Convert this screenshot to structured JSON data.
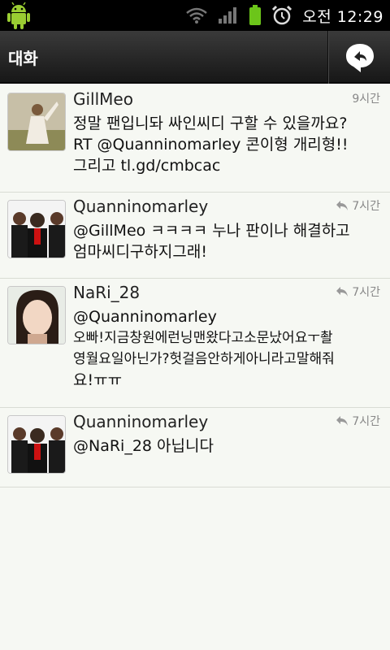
{
  "status": {
    "clock": "오전 12:29"
  },
  "header": {
    "title": "대화"
  },
  "tweets": [
    {
      "name": "GillMeo",
      "time": "9시간",
      "lines": [
        "정말 팬입니돠 싸인씨디 구할 수 있을까요?",
        "RT @Quanninomarley 콘이형 개리형!!",
        "그리고 tl.gd/cmbcac"
      ]
    },
    {
      "name": "Quanninomarley",
      "time": "7시간",
      "lines": [
        "@GillMeo ㅋㅋㅋㅋ 누나 판이나 해결하고",
        "엄마씨디구하지그래!"
      ]
    },
    {
      "name": "NaRi_28",
      "time": "7시간",
      "lines": [
        "@Quanninomarley",
        "오빠!지금창원에런닝맨왔다고소문났어요ㅜ촬",
        "영월요일아닌가?헛걸음안하게아니라고말해줘",
        "요!ㅠㅠ"
      ]
    },
    {
      "name": "Quanninomarley",
      "time": "7시간",
      "lines": [
        "@NaRi_28 아닙니다"
      ]
    }
  ]
}
